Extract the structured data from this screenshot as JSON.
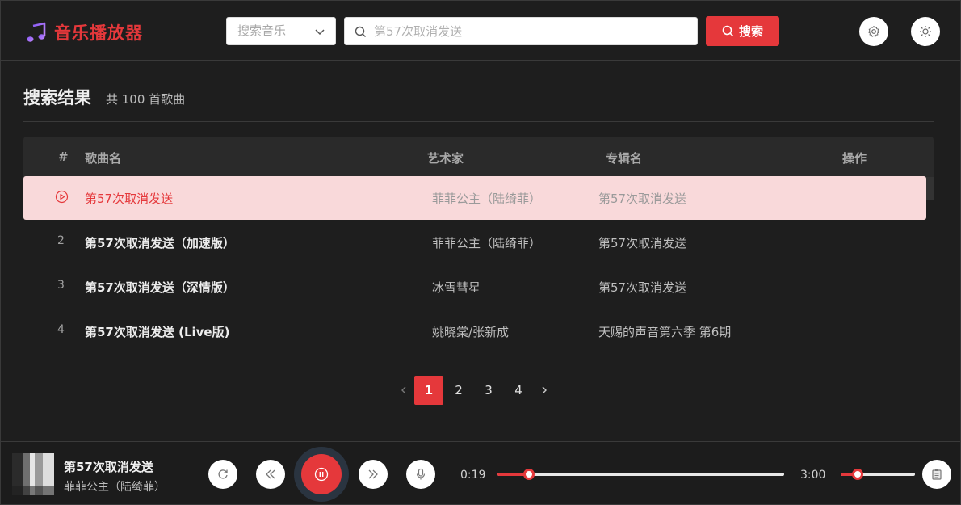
{
  "app": {
    "title": "音乐播放器"
  },
  "header": {
    "source_select": {
      "placeholder": "搜索音乐"
    },
    "search": {
      "value": "",
      "placeholder": "第57次取消发送"
    },
    "search_button_label": "搜索",
    "icons": {
      "settings": "gear-icon",
      "theme": "sun-icon"
    }
  },
  "results": {
    "title": "搜索结果",
    "count_label": "共 100 首歌曲",
    "columns": {
      "index": "#",
      "name": "歌曲名",
      "artist": "艺术家",
      "album": "专辑名",
      "actions": "操作"
    },
    "rows": [
      {
        "index": "",
        "playing": true,
        "name": "第57次取消发送",
        "artist": "菲菲公主（陆绮菲）",
        "album": "第57次取消发送"
      },
      {
        "index": "2",
        "playing": false,
        "name": "第57次取消发送（加速版）",
        "artist": "菲菲公主（陆绮菲）",
        "album": "第57次取消发送"
      },
      {
        "index": "3",
        "playing": false,
        "name": "第57次取消发送（深情版）",
        "artist": "冰雪彗星",
        "album": "第57次取消发送"
      },
      {
        "index": "4",
        "playing": false,
        "name": "第57次取消发送 (Live版)",
        "artist": "姚晓棠/张新成",
        "album": "天赐的声音第六季 第6期"
      }
    ]
  },
  "pagination": {
    "pages": [
      "1",
      "2",
      "3",
      "4"
    ],
    "current": "1"
  },
  "player": {
    "title": "第57次取消发送",
    "artist": "菲菲公主（陆绮菲）",
    "current_time": "0:19",
    "duration": "3:00",
    "progress": 0.11,
    "volume": 0.23,
    "state": "playing"
  },
  "colors": {
    "accent": "#e5383b",
    "background": "#1e1e1e",
    "active_row": "#f9d9da"
  }
}
